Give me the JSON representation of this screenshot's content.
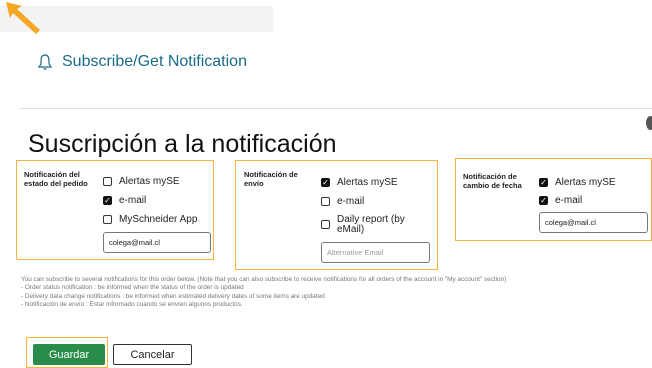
{
  "subscribe_link": {
    "label": "Subscribe/Get Notification"
  },
  "title": "Suscripción a la notificación",
  "panels": [
    {
      "label": "Notificación del estado del pedido",
      "options": [
        {
          "label": "Alertas mySE",
          "checked": false
        },
        {
          "label": "e-mail",
          "checked": true
        },
        {
          "label": "MySchneider App",
          "checked": false
        }
      ],
      "email_value": "colega@mail.cl"
    },
    {
      "label": "Notificación de envío",
      "options": [
        {
          "label": "Alertas mySE",
          "checked": true
        },
        {
          "label": "e-mail",
          "checked": false
        },
        {
          "label": "Daily report (by eMail)",
          "checked": false
        }
      ],
      "email_placeholder": "Alternative Email"
    },
    {
      "label": "Notificación de cambio de fecha",
      "options": [
        {
          "label": "Alertas mySE",
          "checked": true
        },
        {
          "label": "e-mail",
          "checked": true
        }
      ],
      "email_value": "colega@mail.cl"
    }
  ],
  "info": {
    "line1": "You can subscribe to several notifications for this order below. (Note that you can also subscribe to receive notifications for all orders of the account in \"My account\" section)",
    "line2": "- Order status notification : be informed when the status of the order is updated",
    "line3": "- Delivery data change notifications : be informed when estimated delivery dates of some items are updated",
    "line4": "- Notificación de envío : Estar informado cuando se envíen algunos productos."
  },
  "buttons": {
    "save": "Guardar",
    "cancel": "Cancelar"
  },
  "colors": {
    "accent": "#f5b540",
    "primary": "#2a8c4a",
    "link": "#1a6a8a"
  },
  "icons": {
    "arrow": "arrow-icon",
    "bell": "bell-icon",
    "close": "close-icon",
    "check": "check-icon"
  }
}
